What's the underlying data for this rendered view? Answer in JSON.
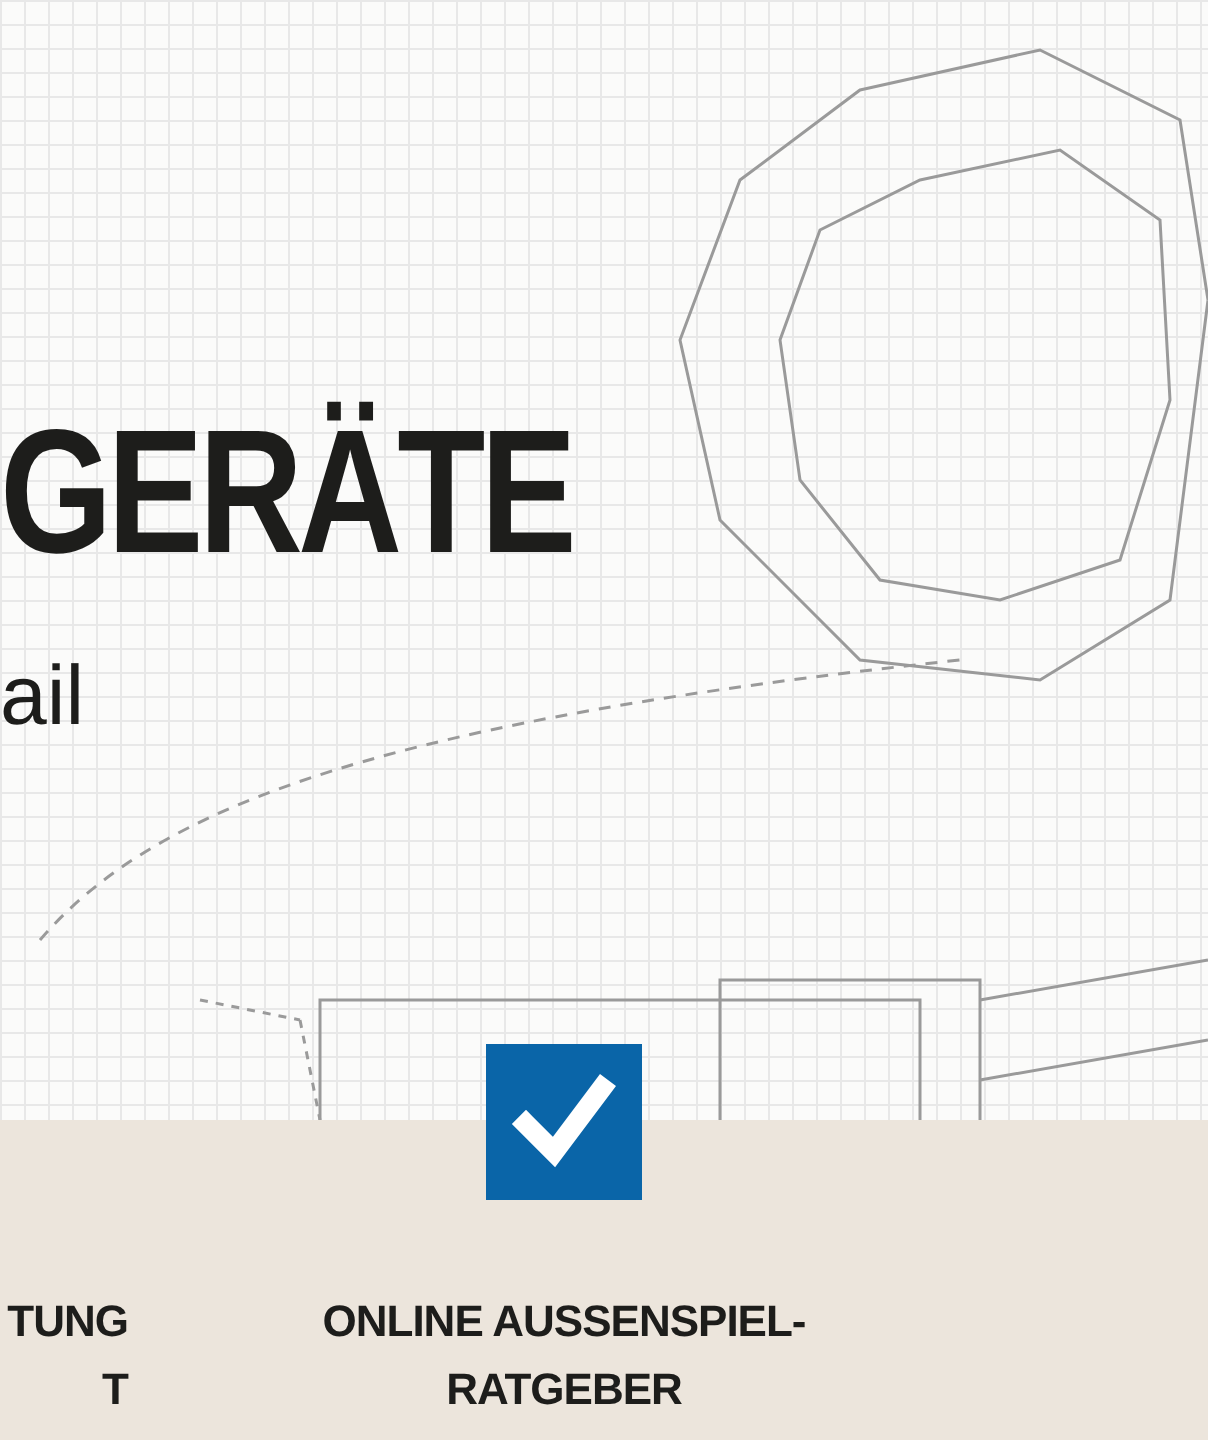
{
  "hero": {
    "title": "GERÄTE",
    "subtitle": "ail"
  },
  "features": [
    {
      "lines": [
        "TUNG",
        "T"
      ]
    },
    {
      "lines": [
        "ONLINE AUSSENSPIEL-",
        "RATGEBER"
      ],
      "checked": true
    }
  ]
}
